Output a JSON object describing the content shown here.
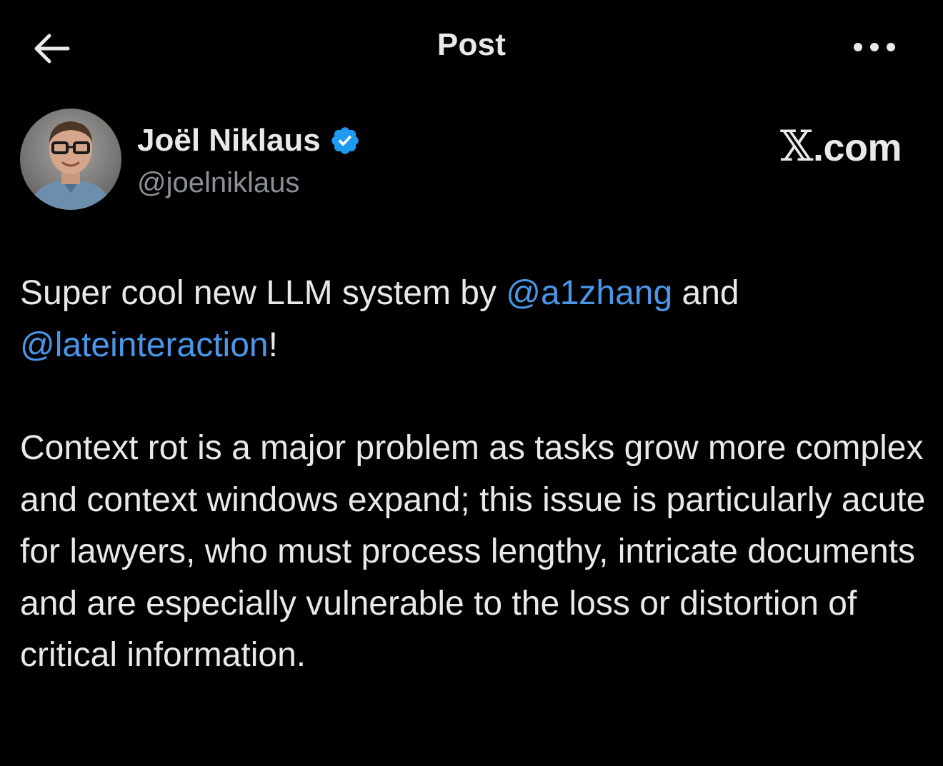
{
  "header": {
    "title": "Post",
    "back_icon": "arrow-left-icon",
    "more_icon": "more-horizontal-icon"
  },
  "author": {
    "name": "Joël Niklaus",
    "handle": "@joelniklaus",
    "verified": true,
    "verified_color": "#1d9bf0"
  },
  "brand": {
    "logo_glyph": "𝕏",
    "logo_text": ".com"
  },
  "post": {
    "line1_pre": "Super cool new LLM system by ",
    "mention1": "@a1zhang",
    "line1_mid": " and ",
    "mention2": "@lateinteraction",
    "line1_post": "!",
    "paragraph2": "Context rot is a major problem as tasks grow more complex and context windows expand; this issue is particularly acute for lawyers, who must process lengthy, intricate documents and are especially vulnerable to the loss or distortion of critical information."
  },
  "colors": {
    "background": "#000000",
    "text": "#e7e9ea",
    "secondary_text": "#8b9096",
    "link": "#4a97e8"
  }
}
